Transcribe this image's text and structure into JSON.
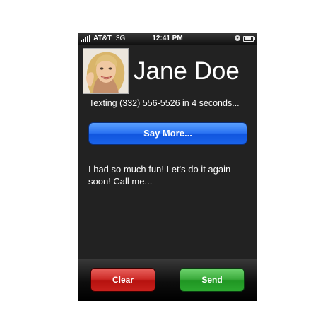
{
  "status_bar": {
    "carrier": "AT&T",
    "network": "3G",
    "time": "12:41 PM",
    "icons": [
      "signal-icon",
      "lock-icon",
      "battery-icon"
    ]
  },
  "contact": {
    "name": "Jane Doe",
    "avatar": "contact-photo"
  },
  "status_text": "Texting (332) 556-5526 in 4 seconds...",
  "say_more_label": "Say More...",
  "message": " I had so much fun! Let's do it again soon! Call me...",
  "actions": {
    "clear_label": "Clear",
    "send_label": "Send"
  },
  "colors": {
    "screen_background": "#222222",
    "say_more_button": "#2a72f2",
    "clear_button": "#cc2a26",
    "send_button": "#3aaa3b"
  }
}
